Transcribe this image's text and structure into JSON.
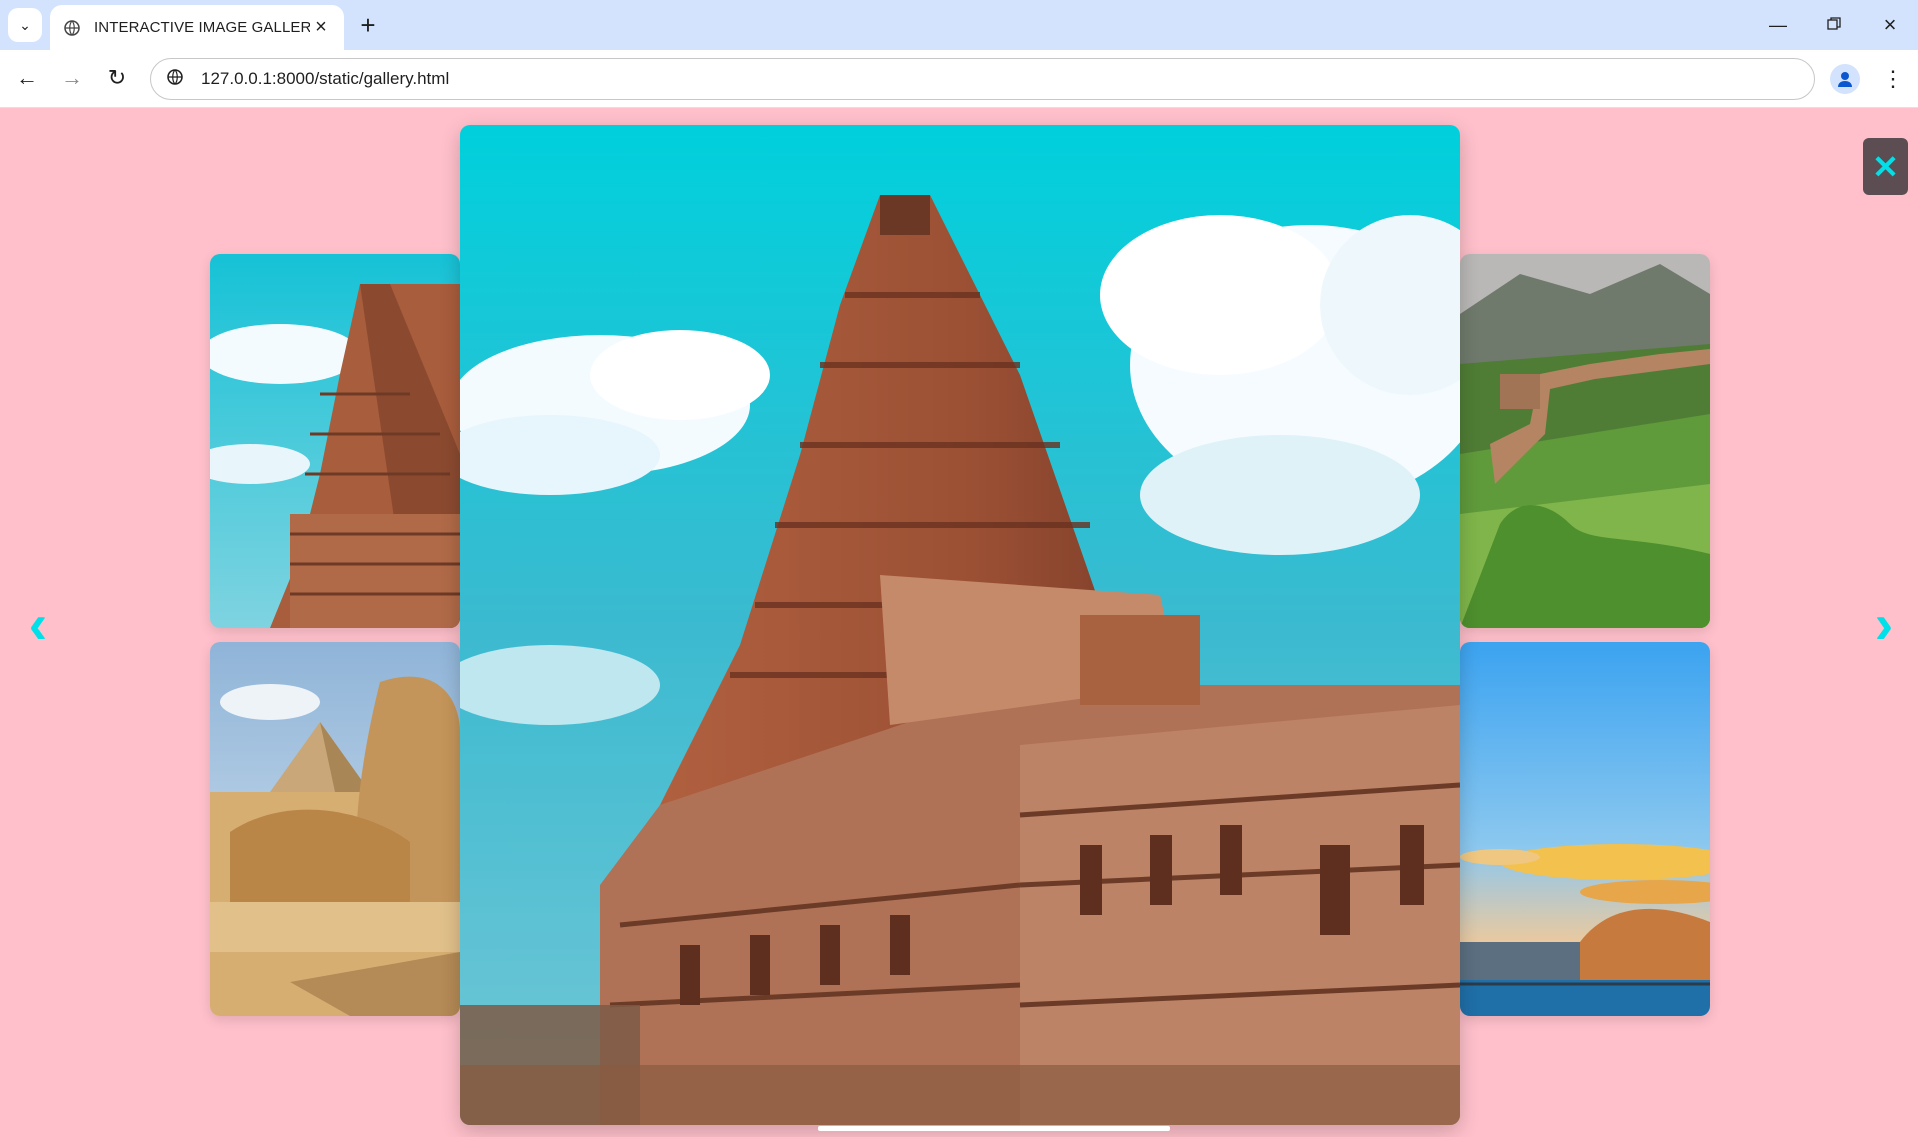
{
  "browser": {
    "tab_title": "INTERACTIVE IMAGE GALLERY",
    "url": "127.0.0.1:8000/static/gallery.html",
    "icons": {
      "tab_search": "chevron-down-icon",
      "favicon": "globe-icon",
      "tab_close": "close-icon",
      "new_tab": "plus-icon",
      "minimize": "minimize-icon",
      "maximize": "restore-icon",
      "window_close": "close-icon",
      "back": "arrow-left-icon",
      "forward": "arrow-right-icon",
      "reload": "reload-icon",
      "site_info": "site-info-icon",
      "profile": "profile-icon",
      "menu": "kebab-menu-icon"
    }
  },
  "gallery": {
    "prev_label": "‹",
    "next_label": "›",
    "close_label": "✕",
    "accent_color": "#00e0e8",
    "background_color": "#ffc0cb",
    "images": [
      {
        "slot": "main",
        "subject": "Brihadeeswarar temple tower"
      },
      {
        "slot": "thumb-top-left",
        "subject": "Brihadeeswarar temple tower"
      },
      {
        "slot": "thumb-bottom-left",
        "subject": "Sphinx and pyramid"
      },
      {
        "slot": "thumb-top-right",
        "subject": "Great Wall of China"
      },
      {
        "slot": "thumb-bottom-right",
        "subject": "Sunset sky over waterfront"
      }
    ]
  }
}
